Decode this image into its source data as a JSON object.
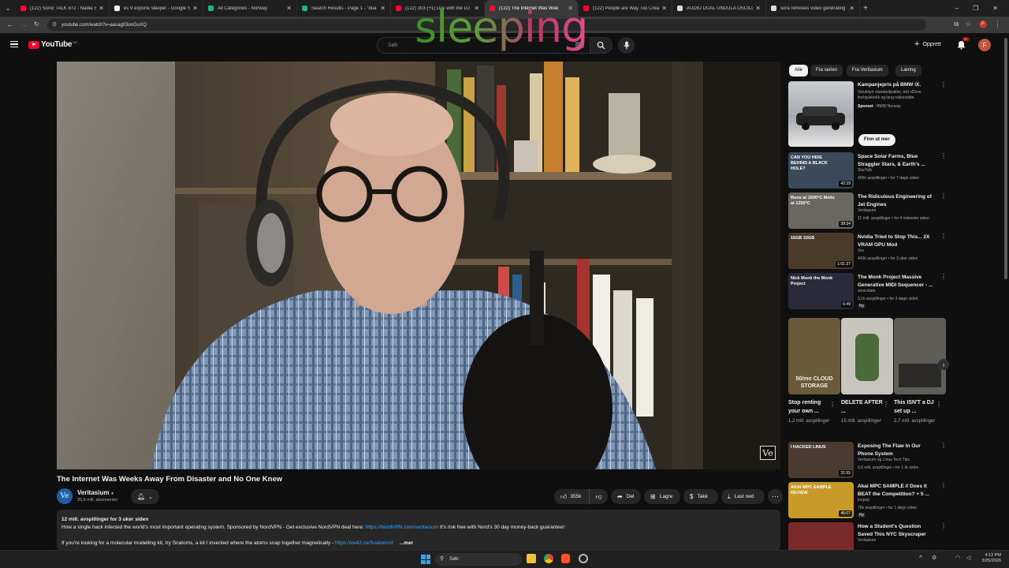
{
  "browser": {
    "tabs": [
      {
        "title": "(122) Sonic TALK 872 - Nadia S",
        "color": "#ff0033",
        "active": false
      },
      {
        "title": "es 9 exporte sleeper - Google S",
        "color": "#ffffff",
        "active": false
      },
      {
        "title": "All Categories - Norway",
        "color": "#1fb57a",
        "active": false
      },
      {
        "title": "Search Results - Page 1 - \"dua",
        "color": "#1fb57a",
        "active": false
      },
      {
        "title": "(122) 303 (+1) Day with the DJ",
        "color": "#ff0033",
        "active": false
      },
      {
        "title": "(122) The Internet Was Wee",
        "color": "#ff0033",
        "active": true
      },
      {
        "title": "(122) People are Way Too Crea",
        "color": "#ff0033",
        "active": false
      },
      {
        "title": "AUDIO DUAL UNDULA OSCILL",
        "color": "#dddddd",
        "active": false
      },
      {
        "title": "sora removes video generating",
        "color": "#dddddd",
        "active": false
      }
    ],
    "url": "youtube.com/watch?v=aasag03onGuXQ"
  },
  "overlay_word": "sleeping",
  "masthead": {
    "logo_text": "YouTube",
    "logo_sup": "NO",
    "search_placeholder": "Søk",
    "create_label": "Opprett",
    "notif_badge": "9+",
    "avatar_letter": "F"
  },
  "video": {
    "watermark": "Ve",
    "title": "The Internet Was Weeks Away From Disaster and No One Knew"
  },
  "channel": {
    "avatar_text": "Ve",
    "name": "Veritasium",
    "subs": "20,5 mill. abonnenter"
  },
  "actions": {
    "likes": "355k",
    "share": "Del",
    "save": "Lagre",
    "thanks": "Takk",
    "download": "Last ned"
  },
  "description": {
    "stats": "12 mill. avspillinger  for 3 uker siden",
    "line1_before": "How a single hack infected the world's most important operating system. Sponsored by NordVPN - Get exclusive NordVPN deal here: ",
    "line1_link": "https://NordVPN.com/veritasium",
    "line1_after": " It's risk free with Nord's 30 day money-back guarantee!",
    "line2_before": "If you're looking for a molecular modelling kit, try Snatoms, a kit I invented where the atoms snap together magnetically - ",
    "line2_link": "https://ve42.co/SnatomsV",
    "more": "...mer"
  },
  "sidebar": {
    "chips": [
      "Alle",
      "Fra serien",
      "Fra Veritasium",
      "Læring"
    ],
    "ad": {
      "title": "Kampanjepris på BMW iX.",
      "desc": "Velutstyrt standardpakke, inkl xDrive firehjulstrekk og lang rekkevidde.",
      "sponsored": "Sponset",
      "advertiser": "BMW Norway",
      "cta": "Finn ut mer"
    },
    "videos": [
      {
        "title": "Space Solar Farms, Blue Straggler Stars, & Earth's ...",
        "channel": "StarTalk",
        "meta": "405k avspillinger • for 7 døgn siden",
        "duration": "42:29",
        "thumb_text": "CAN YOU HIDE BEHIND A BLACK HOLE?"
      },
      {
        "title": "The Ridiculous Engineering of Jet Engines",
        "channel": "Veritasium",
        "meta": "11 mill. avspillinger • for 4 måneder siden",
        "duration": "39:34",
        "thumb_text": "Runs at 1500°C Melts at 1250°C"
      },
      {
        "title": "Nvidia Tried to Stop This... 2X VRAM GPU Mod",
        "channel": "Vex",
        "meta": "443k avspillinger • for 3 uker siden",
        "duration": "1:01:37",
        "thumb_text": "16GB 32GB"
      },
      {
        "title": "The Monk Project Massive Generative MIDI Sequencer - ...",
        "channel": "sonicstate",
        "meta": "3,1k avspillinger • for 3 døgn siden",
        "duration": "6:49",
        "thumb_text": "Nick Monk the Monk Project",
        "badge": "Ny"
      },
      {
        "title": "Exposing The Flaw In Our Phone System",
        "channel": "Veritasium og Linus Tech Tips",
        "meta": "9,5 mill. avspillinger • for 1 år siden",
        "duration": "31:55",
        "thumb_text": "I HACKED LINUS"
      },
      {
        "title": "Akai MPC SAMPLE // Does it BEAT the Competition? + 5 ...",
        "channel": "loopop",
        "meta": "70k avspillinger • for 1 døgn siden",
        "duration": "46:07",
        "thumb_text": "AKAI MPC SAMPLE  REVIEW",
        "badge": "Ny"
      },
      {
        "title": "How a Student's Question Saved This NYC Skyscraper",
        "channel": "Veritasium",
        "meta": "",
        "duration": "",
        "thumb_text": ""
      }
    ],
    "shorts": [
      {
        "title": "Stop renting your own ...",
        "views": "1,2 mill. avspillinger",
        "overlay": "50/mo CLOUD STORAGE"
      },
      {
        "title": "DELETE AFTER ...",
        "views": "15 mill. avspillinger",
        "overlay": ""
      },
      {
        "title": "This ISN'T a DJ set up ...",
        "views": "2,7 mill. avspillinger",
        "overlay": ""
      }
    ]
  },
  "taskbar": {
    "search": "Søk",
    "time": "4:12 PM",
    "date": "3/25/2026"
  }
}
